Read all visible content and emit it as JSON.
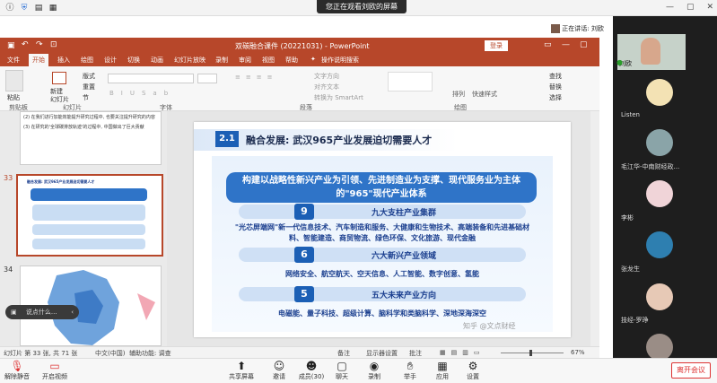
{
  "meeting": {
    "share_banner": "您正在观看刘欧的屏幕",
    "speaking_label": "正在讲话: 刘欧",
    "leave_button": "离开会议",
    "toolbar": [
      {
        "name": "mute",
        "label": "解除静音",
        "icon": "mic-off-icon"
      },
      {
        "name": "video",
        "label": "开启视频",
        "icon": "video-off-icon"
      },
      {
        "name": "share",
        "label": "共享屏幕",
        "icon": "screen-share-icon"
      },
      {
        "name": "invite",
        "label": "邀请",
        "icon": "invite-icon"
      },
      {
        "name": "members",
        "label": "成员(30)",
        "icon": "members-icon"
      },
      {
        "name": "chat",
        "label": "聊天",
        "icon": "chat-icon"
      },
      {
        "name": "record",
        "label": "录制",
        "icon": "record-icon"
      },
      {
        "name": "hand",
        "label": "举手",
        "icon": "hand-icon"
      },
      {
        "name": "apps",
        "label": "应用",
        "icon": "apps-icon"
      },
      {
        "name": "settings",
        "label": "设置",
        "icon": "gear-icon"
      }
    ],
    "participants": [
      {
        "name": "刘欧"
      },
      {
        "name": "Listen"
      },
      {
        "name": "毛江华-中南财经政..."
      },
      {
        "name": "李彬"
      },
      {
        "name": "张龙生"
      },
      {
        "name": "技经-罗琤"
      },
      {
        "name": ""
      }
    ],
    "chat_input_placeholder": "说点什么..."
  },
  "ppt": {
    "window_title": "双碳融合课件 (20221031) - PowerPoint",
    "login_button": "登录",
    "menu": [
      "文件",
      "开始",
      "插入",
      "绘图",
      "设计",
      "切换",
      "动画",
      "幻灯片放映",
      "录制",
      "审阅",
      "视图",
      "帮助",
      "操作说明搜索"
    ],
    "active_tab": "开始",
    "ribbon_groups": [
      "剪贴板",
      "幻灯片",
      "字体",
      "段落",
      "绘图"
    ],
    "ribbon_items": {
      "paste": "粘贴",
      "new_slide": "新建\n幻灯片",
      "layout": "版式",
      "reset": "重置",
      "section": "节",
      "text_direction": "文字方向",
      "align_text": "对齐文本",
      "smartart": "转换为 SmartArt",
      "arrange": "排列",
      "quick_styles": "快速样式",
      "find": "查找",
      "replace": "替换",
      "select": "选择"
    },
    "thumbnails": [
      {
        "number": "",
        "text": [
          "(2) 在我们进行加能效能提升研究过程中, 也要关注提升研究的内容",
          "(3) 在研究的'全球碳排放轨迹'的过程中, 中国做出了巨大贡献"
        ]
      },
      {
        "number": "33",
        "text": [
          "融合发展: 武汉965产业发展迫切需要人才"
        ]
      },
      {
        "number": "34",
        "text": []
      }
    ],
    "slide": {
      "section_no": "2.1",
      "title": "融合发展: 武汉965产业发展迫切需要人才",
      "headline": "构建以战略性新兴产业为引领、先进制造业为支撑、现代服务业为主体的\"965\"现代产业体系",
      "blocks": [
        {
          "digit": "9",
          "heading": "九大支柱产业集群",
          "body": "\"光芯屏端网\"新一代信息技术、汽车制造和服务、大健康和生物技术、高端装备和先进基础材料、智能建造、商贸物流、绿色环保、文化旅游、现代金融"
        },
        {
          "digit": "6",
          "heading": "六大新兴产业领域",
          "body": "网络安全、航空航天、空天信息、人工智能、数字创意、氢能"
        },
        {
          "digit": "5",
          "heading": "五大未来产业方向",
          "body": "电磁能、量子科技、超级计算、脑科学和类脑科学、深地深海深空"
        }
      ],
      "watermark": "知乎 @文点财经"
    },
    "status": {
      "slide_info": "幻灯片 第 33 张, 共 71 张",
      "language": "中文(中国)",
      "accessibility": "辅助功能: 调查",
      "notes": "备注",
      "display_settings": "显示器设置",
      "comments": "批注",
      "zoom": "67%"
    }
  }
}
